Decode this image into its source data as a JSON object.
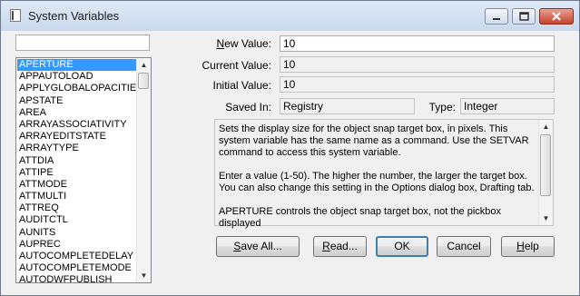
{
  "window": {
    "title": "System Variables"
  },
  "search": {
    "value": ""
  },
  "variables": [
    "APERTURE",
    "APPAUTOLOAD",
    "APPLYGLOBALOPACITIES",
    "APSTATE",
    "AREA",
    "ARRAYASSOCIATIVITY",
    "ARRAYEDITSTATE",
    "ARRAYTYPE",
    "ATTDIA",
    "ATTIPE",
    "ATTMODE",
    "ATTMULTI",
    "ATTREQ",
    "AUDITCTL",
    "AUNITS",
    "AUPREC",
    "AUTOCOMPLETEDELAY",
    "AUTOCOMPLETEMODE",
    "AUTODWFPUBLISH"
  ],
  "selected_variable": "APERTURE",
  "fields": {
    "new_value_label_u": "N",
    "new_value_label_rest": "ew Value:",
    "new_value": "10",
    "current_value_label": "Current Value:",
    "current_value": "10",
    "initial_value_label": "Initial Value:",
    "initial_value": "10",
    "saved_in_label": "Saved In:",
    "saved_in": "Registry",
    "type_label": "Type:",
    "type": "Integer"
  },
  "description": {
    "p1": "Sets the display size for the object snap target box, in pixels. This system variable has the same name as a command. Use the SETVAR command to access this system variable.",
    "p2": "Enter a value (1-50). The higher the number, the larger the target box. You can also change this setting in the Options dialog box, Drafting tab.",
    "p3": "APERTURE controls the object snap target box, not the pickbox displayed"
  },
  "buttons": {
    "save_all_u": "S",
    "save_all_rest": "ave All...",
    "read_u": "R",
    "read_rest": "ead...",
    "ok": "OK",
    "cancel": "Cancel",
    "help_u": "H",
    "help_rest": "elp"
  },
  "colors": {
    "selection": "#3399ff",
    "default_button_border": "#3c7fb1",
    "close_button": "#c4432d"
  },
  "icons": [
    "app-icon",
    "minimize-icon",
    "maximize-icon",
    "close-icon",
    "scroll-up-icon",
    "scroll-down-icon"
  ]
}
